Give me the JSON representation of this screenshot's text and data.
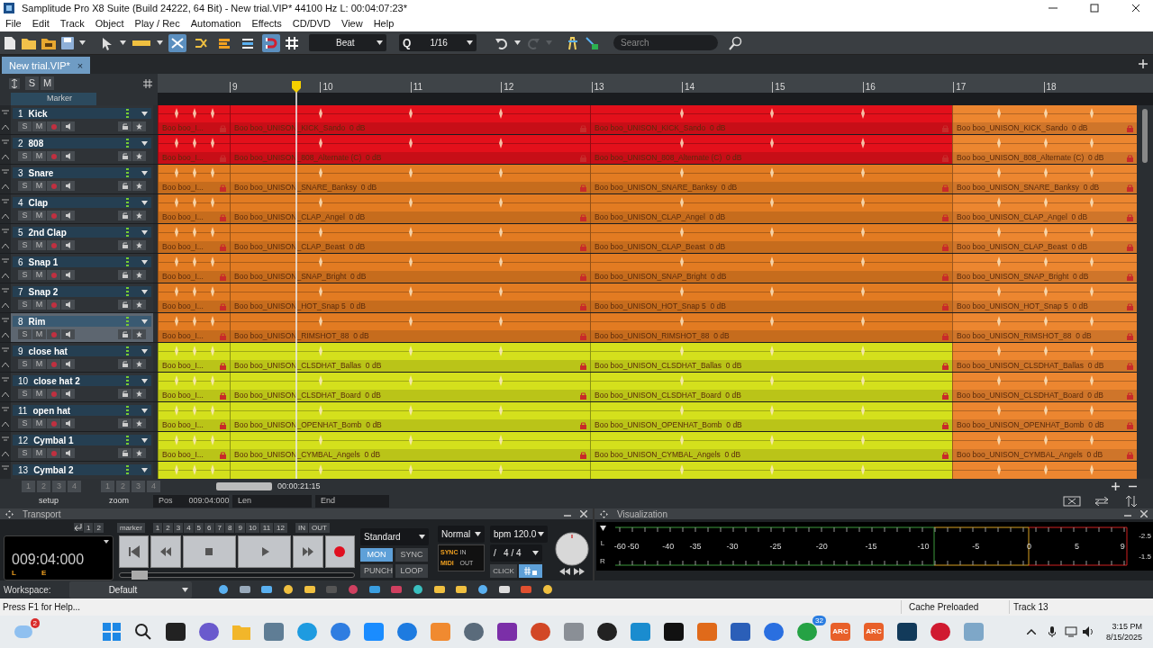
{
  "window": {
    "title": "Samplitude Pro X8 Suite (Build 24222, 64 Bit)  -  New trial.VIP*  44100 Hz L: 00:04:07:23*"
  },
  "menu": [
    "File",
    "Edit",
    "Track",
    "Object",
    "Play / Rec",
    "Automation",
    "Effects",
    "CD/DVD",
    "View",
    "Help"
  ],
  "toolbar": {
    "tools": [
      {
        "kind": "crossfade",
        "selected": true
      },
      {
        "kind": "split",
        "selected": false
      },
      {
        "kind": "bars",
        "selected": false
      },
      {
        "kind": "lines",
        "selected": false
      },
      {
        "kind": "magnet",
        "selected": true
      }
    ],
    "snap": "Beat",
    "quantize_label": "Q",
    "quantize": "1/16",
    "redo": {
      "disabled": true
    },
    "search_placeholder": "Search"
  },
  "tabs": [
    {
      "label": "New trial.VIP*",
      "selected": true,
      "close": "×"
    }
  ],
  "arrange": {
    "header_buttons": [
      "S",
      "M"
    ],
    "marker_label": "Marker",
    "ruler": [
      "9",
      "10",
      "11",
      "12",
      "13",
      "14",
      "15",
      "16",
      "17",
      "18"
    ]
  },
  "tracks": [
    {
      "number": "1",
      "name": "Kick",
      "selected": false,
      "buttons": [
        "S",
        "M"
      ],
      "clips": [
        {
          "label": "Boo boo_I...",
          "color": "#e3101b"
        },
        {
          "label": "Boo boo_UNISON_KICK_Sando  0 dB",
          "color": "#e3101b"
        },
        {
          "label": "Boo boo_UNISON_KICK_Sando  0 dB",
          "color": "#e3101b"
        },
        {
          "label": "Boo boo_UNISON_KICK_Sando  0 dB",
          "color": "#ec8630"
        }
      ]
    },
    {
      "number": "2",
      "name": "808",
      "selected": false,
      "buttons": [
        "S",
        "M"
      ],
      "clips": [
        {
          "label": "Boo boo_I...",
          "color": "#e3101b"
        },
        {
          "label": "Boo boo_UNISON_808_Alternate (C)  0 dB",
          "color": "#e3101b"
        },
        {
          "label": "Boo boo_UNISON_808_Alternate (C)  0 dB",
          "color": "#e3101b"
        },
        {
          "label": "Boo boo_UNISON_808_Alternate (C)  0 dB",
          "color": "#ec8630"
        }
      ]
    },
    {
      "number": "3",
      "name": "Snare",
      "selected": false,
      "buttons": [
        "S",
        "M"
      ],
      "clips": [
        {
          "label": "Boo boo_I...",
          "color": "#e27b22"
        },
        {
          "label": "Boo boo_UNISON_SNARE_Banksy  0 dB",
          "color": "#e27b22"
        },
        {
          "label": "Boo boo_UNISON_SNARE_Banksy  0 dB",
          "color": "#e27b22"
        },
        {
          "label": "Boo boo_UNISON_SNARE_Banksy  0 dB",
          "color": "#ec8630"
        }
      ]
    },
    {
      "number": "4",
      "name": "Clap",
      "selected": false,
      "buttons": [
        "S",
        "M"
      ],
      "clips": [
        {
          "label": "Boo boo_I...",
          "color": "#e27b22"
        },
        {
          "label": "Boo boo_UNISON_CLAP_Angel  0 dB",
          "color": "#e27b22"
        },
        {
          "label": "Boo boo_UNISON_CLAP_Angel  0 dB",
          "color": "#e27b22"
        },
        {
          "label": "Boo boo_UNISON_CLAP_Angel  0 dB",
          "color": "#ec8630"
        }
      ]
    },
    {
      "number": "5",
      "name": "2nd Clap",
      "selected": false,
      "buttons": [
        "S",
        "M"
      ],
      "clips": [
        {
          "label": "Boo boo_I...",
          "color": "#e27b22"
        },
        {
          "label": "Boo boo_UNISON_CLAP_Beast  0 dB",
          "color": "#e27b22"
        },
        {
          "label": "Boo boo_UNISON_CLAP_Beast  0 dB",
          "color": "#e27b22"
        },
        {
          "label": "Boo boo_UNISON_CLAP_Beast  0 dB",
          "color": "#ec8630"
        }
      ]
    },
    {
      "number": "6",
      "name": "Snap 1",
      "selected": false,
      "buttons": [
        "S",
        "M"
      ],
      "clips": [
        {
          "label": "Boo boo_I...",
          "color": "#e27b22"
        },
        {
          "label": "Boo boo_UNISON_SNAP_Bright  0 dB",
          "color": "#e27b22"
        },
        {
          "label": "Boo boo_UNISON_SNAP_Bright  0 dB",
          "color": "#e27b22"
        },
        {
          "label": "Boo boo_UNISON_SNAP_Bright  0 dB",
          "color": "#ec8630"
        }
      ]
    },
    {
      "number": "7",
      "name": "Snap 2",
      "selected": false,
      "buttons": [
        "S",
        "M"
      ],
      "clips": [
        {
          "label": "Boo boo_I...",
          "color": "#e27b22"
        },
        {
          "label": "Boo boo_UNISON_HOT_Snap 5  0 dB",
          "color": "#e27b22"
        },
        {
          "label": "Boo boo_UNISON_HOT_Snap 5  0 dB",
          "color": "#e27b22"
        },
        {
          "label": "Boo boo_UNISON_HOT_Snap 5  0 dB",
          "color": "#ec8630"
        }
      ]
    },
    {
      "number": "8",
      "name": "Rim",
      "selected": true,
      "buttons": [
        "S",
        "M"
      ],
      "clips": [
        {
          "label": "Boo boo_I...",
          "color": "#e27b22"
        },
        {
          "label": "Boo boo_UNISON_RIMSHOT_88  0 dB",
          "color": "#e27b22"
        },
        {
          "label": "Boo boo_UNISON_RIMSHOT_88  0 dB",
          "color": "#e27b22"
        },
        {
          "label": "Boo boo_UNISON_RIMSHOT_88  0 dB",
          "color": "#ec8630"
        }
      ]
    },
    {
      "number": "9",
      "name": "close hat",
      "selected": false,
      "buttons": [
        "S",
        "M"
      ],
      "clips": [
        {
          "label": "Boo boo_I...",
          "color": "#d4e01c"
        },
        {
          "label": "Boo boo_UNISON_CLSDHAT_Ballas  0 dB",
          "color": "#d4e01c"
        },
        {
          "label": "Boo boo_UNISON_CLSDHAT_Ballas  0 dB",
          "color": "#d4e01c"
        },
        {
          "label": "Boo boo_UNISON_CLSDHAT_Ballas  0 dB",
          "color": "#ec8630"
        }
      ]
    },
    {
      "number": "10",
      "name": "close hat 2",
      "selected": false,
      "buttons": [
        "S",
        "M"
      ],
      "clips": [
        {
          "label": "Boo boo_I...",
          "color": "#d4e01c"
        },
        {
          "label": "Boo boo_UNISON_CLSDHAT_Board  0 dB",
          "color": "#d4e01c"
        },
        {
          "label": "Boo boo_UNISON_CLSDHAT_Board  0 dB",
          "color": "#d4e01c"
        },
        {
          "label": "Boo boo_UNISON_CLSDHAT_Board  0 dB",
          "color": "#ec8630"
        }
      ]
    },
    {
      "number": "11",
      "name": "open hat",
      "selected": false,
      "buttons": [
        "S",
        "M"
      ],
      "clips": [
        {
          "label": "Boo boo_I...",
          "color": "#d4e01c"
        },
        {
          "label": "Boo boo_UNISON_OPENHAT_Bomb  0 dB",
          "color": "#d4e01c"
        },
        {
          "label": "Boo boo_UNISON_OPENHAT_Bomb  0 dB",
          "color": "#d4e01c"
        },
        {
          "label": "Boo boo_UNISON_OPENHAT_Bomb  0 dB",
          "color": "#ec8630"
        }
      ]
    },
    {
      "number": "12",
      "name": "Cymbal 1",
      "selected": false,
      "buttons": [
        "S",
        "M"
      ],
      "clips": [
        {
          "label": "Boo boo_I...",
          "color": "#d4e01c"
        },
        {
          "label": "Boo boo_UNISON_CYMBAL_Angels  0 dB",
          "color": "#d4e01c"
        },
        {
          "label": "Boo boo_UNISON_CYMBAL_Angels  0 dB",
          "color": "#d4e01c"
        },
        {
          "label": "Boo boo_UNISON_CYMBAL_Angels  0 dB",
          "color": "#ec8630"
        }
      ]
    },
    {
      "number": "13",
      "name": "Cymbal 2",
      "selected": false,
      "clips": [
        {
          "color": "#d4e01c"
        },
        {
          "color": "#d4e01c"
        },
        {
          "color": "#d4e01c"
        },
        {
          "color": "#ec8630"
        }
      ]
    }
  ],
  "arrange_footer": {
    "setup_buttons": [
      "1",
      "2",
      "3",
      "4"
    ],
    "setup_label": "setup",
    "zoom_buttons": [
      "1",
      "2",
      "3",
      "4"
    ],
    "zoom_label": "zoom",
    "scroll_time": "00:00:21:15",
    "pos_label": "Pos",
    "pos": "009:04:000",
    "len_label": "Len",
    "end_label": "End"
  },
  "transport": {
    "title": "Transport",
    "undo_buttons": [
      "1",
      "2"
    ],
    "marker_label": "marker",
    "marker_buttons": [
      "1",
      "2",
      "3",
      "4",
      "5",
      "6",
      "7",
      "8",
      "9",
      "10",
      "11",
      "12"
    ],
    "in": "IN",
    "out": "OUT",
    "time": "009:04:000",
    "flags": [
      "L",
      "E"
    ],
    "level": 0.05,
    "mode": "Standard",
    "buttons": [
      {
        "label": "MON",
        "selected": true
      },
      {
        "label": "SYNC",
        "selected": false
      },
      {
        "label": "PUNCH",
        "selected": false
      },
      {
        "label": "LOOP",
        "selected": false
      }
    ],
    "play_mode": "Normal",
    "bpm": "bpm 120.0",
    "signature": "/   4 / 4",
    "sync": "SYNC",
    "midi": "MIDI",
    "in_label": "IN",
    "out_label": "OUT",
    "click": "CLICK",
    "lock": {
      "selected": true
    }
  },
  "visualization": {
    "title": "Visualization",
    "channels": [
      "L",
      "R"
    ],
    "scale": [
      "-60",
      "-50",
      "-40",
      "-35",
      "-30",
      "-25",
      "-20",
      "-15",
      "-10",
      "-5",
      "0",
      "5",
      "9"
    ],
    "peaks": [
      "-2.5",
      "-1.5"
    ]
  },
  "workspace": {
    "label": "Workspace:",
    "value": "Default"
  },
  "status_bar": {
    "help": "Press F1 for Help...",
    "cache": "Cache Preloaded",
    "track": "Track 13"
  },
  "taskbar": {
    "weather_badge": "2",
    "apps": [
      {
        "kind": "windows",
        "color": "#1e88e5"
      },
      {
        "kind": "search",
        "color": "#222222"
      },
      {
        "kind": "tile",
        "color": "#222222"
      },
      {
        "kind": "circle",
        "color": "#6a5acd"
      },
      {
        "kind": "folder",
        "color": "#f2b62a"
      },
      {
        "kind": "tile",
        "color": "#5f7d95"
      },
      {
        "kind": "circle",
        "color": "#1e9be0"
      },
      {
        "kind": "circle",
        "color": "#2f7de1"
      },
      {
        "kind": "tile",
        "color": "#1a8cff"
      },
      {
        "kind": "circle",
        "color": "#1e7be0"
      },
      {
        "kind": "tile",
        "color": "#f08a30"
      },
      {
        "kind": "circle",
        "color": "#5a6b7b"
      },
      {
        "kind": "tile",
        "color": "#7b2fa8"
      },
      {
        "kind": "circle",
        "color": "#d24726"
      },
      {
        "kind": "tile",
        "color": "#8a8f96"
      },
      {
        "kind": "circle",
        "color": "#222222"
      },
      {
        "kind": "tile",
        "color": "#1a8ccf"
      },
      {
        "kind": "tile",
        "color": "#111111"
      },
      {
        "kind": "tile",
        "color": "#e06a1a"
      },
      {
        "kind": "tile",
        "color": "#2b5fb8"
      },
      {
        "kind": "circle",
        "color": "#2a6fe0"
      },
      {
        "kind": "circle",
        "color": "#25a244",
        "badge": "32"
      },
      {
        "kind": "tile",
        "color": "#e8602a",
        "label": "ARC"
      },
      {
        "kind": "tile",
        "color": "#e8602a",
        "label": "ARC"
      },
      {
        "kind": "tile",
        "color": "#123a5a"
      },
      {
        "kind": "circle",
        "color": "#d01a30"
      },
      {
        "kind": "tile",
        "color": "#7ea7c8"
      }
    ],
    "time": "3:15 PM",
    "date": "8/15/2025"
  }
}
